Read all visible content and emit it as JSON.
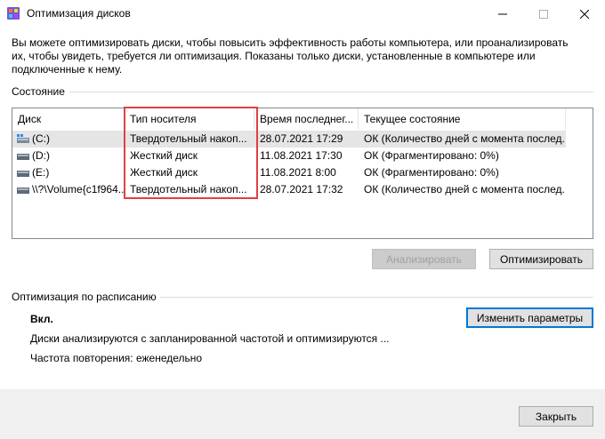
{
  "window": {
    "title": "Оптимизация дисков",
    "icon": "defrag-app-icon"
  },
  "description": "Вы можете оптимизировать диски, чтобы повысить эффективность работы  компьютера, или проанализировать их, чтобы увидеть, требуется ли оптимизация. Показаны только диски, установленные в компьютере или подключенные к нему.",
  "status": {
    "label": "Состояние",
    "columns": [
      "Диск",
      "Тип носителя",
      "Время последнег...",
      "Текущее состояние"
    ],
    "rows": [
      {
        "drive": "(C:)",
        "icon": "system-drive-icon",
        "media": "Твердотельный накоп...",
        "time": "28.07.2021 17:29",
        "state": "ОК (Количество дней с момента послед...",
        "selected": true
      },
      {
        "drive": "(D:)",
        "icon": "hard-drive-icon",
        "media": "Жесткий диск",
        "time": "11.08.2021 17:30",
        "state": "ОК (Фрагментировано: 0%)",
        "selected": false
      },
      {
        "drive": "(E:)",
        "icon": "hard-drive-icon",
        "media": "Жесткий диск",
        "time": "11.08.2021 8:00",
        "state": "ОК (Фрагментировано: 0%)",
        "selected": false
      },
      {
        "drive": "\\\\?\\Volume{c1f964...",
        "icon": "hard-drive-icon",
        "media": "Твердотельный накоп...",
        "time": "28.07.2021 17:32",
        "state": "ОК (Количество дней с момента послед...",
        "selected": false
      }
    ],
    "analyze_label": "Анализировать",
    "optimize_label": "Оптимизировать"
  },
  "schedule": {
    "label": "Оптимизация по расписанию",
    "status": "Вкл.",
    "description": "Диски анализируются с запланированной частотой и оптимизируются ...",
    "frequency": "Частота повторения: еженедельно",
    "change_label": "Изменить параметры"
  },
  "footer": {
    "close_label": "Закрыть"
  },
  "colors": {
    "highlight": "#e04040",
    "selected_row": "#e5e5e5",
    "default_button_border": "#0078d7"
  }
}
